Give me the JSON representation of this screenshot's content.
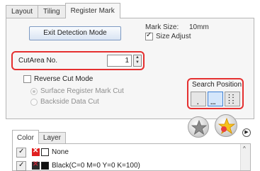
{
  "tabs": [
    "Layout",
    "Tiling",
    "Register Mark"
  ],
  "active_tab": "Register Mark",
  "register_mark": {
    "exit_button": "Exit Detection Mode",
    "mark_size_label": "Mark Size:",
    "mark_size_value": "10mm",
    "size_adjust_label": "Size Adjust",
    "size_adjust_checked": true,
    "cut_area_label": "CutArea No.",
    "cut_area_value": "1",
    "reverse_cut_label": "Reverse Cut Mode",
    "reverse_cut_checked": false,
    "radio_surface": "Surface Register Mark Cut",
    "radio_backside": "Backside Data Cut",
    "search_position_label": "Search Position",
    "search_positions": [
      "bottom-center",
      "bottom-2-points",
      "4-corners"
    ],
    "search_position_selected": 1
  },
  "lower_tabs": [
    "Color",
    "Layer"
  ],
  "lower_active_tab": "Color",
  "colors": [
    {
      "label": "None",
      "visible": true
    },
    {
      "label": "Black(C=0 M=0 Y=0 K=100)",
      "visible": true
    }
  ],
  "accent": {
    "highlight_border": "#e53030",
    "selected": "#3e7fd2"
  }
}
